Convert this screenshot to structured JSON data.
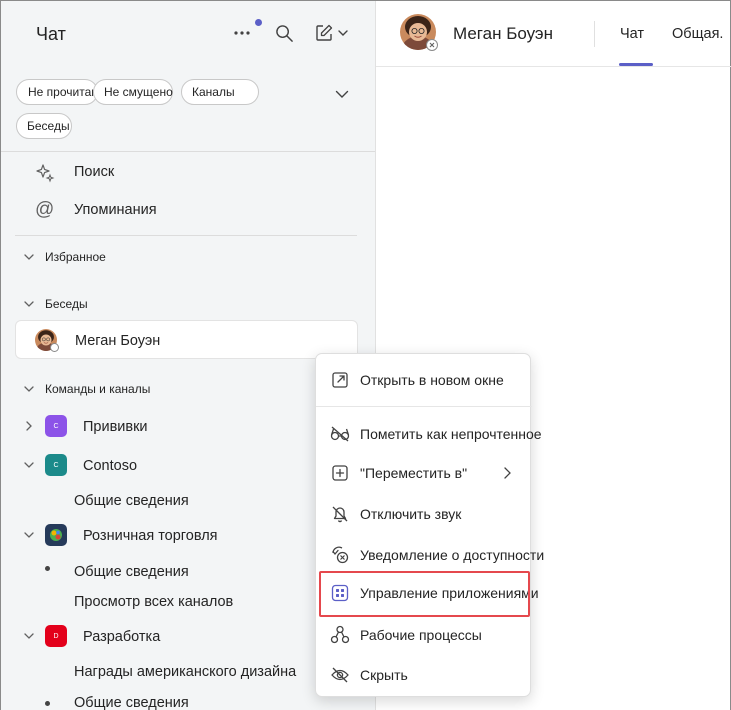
{
  "sidebar": {
    "title": "Чат",
    "filters": [
      "Не прочитано",
      "Не смущено",
      "Каналы",
      "Беседы"
    ],
    "quick": [
      {
        "label": "Поиск",
        "icon": "sparkle-icon"
      },
      {
        "label": "Упоминания",
        "icon": "at-icon"
      }
    ],
    "sections": {
      "favorites": "Избранное",
      "chats": "Беседы",
      "teams": "Команды и каналы"
    },
    "chat_item": "Меган Боуэн",
    "teams": [
      {
        "name": "Прививки",
        "letter": "C",
        "color": "#8c53e8"
      },
      {
        "name": "Contoso",
        "letter": "C",
        "color": "#1b8a8a"
      },
      {
        "name": "Розничная торговля",
        "letter": "",
        "color": "#253a5a"
      },
      {
        "name": "Разработка",
        "letter": "D",
        "color": "#e3001b"
      }
    ],
    "channels": {
      "contoso_general": "Общие сведения",
      "retail_general": "Общие сведения",
      "retail_all": "Просмотр всех каналов",
      "dev_awards": "Награды американского дизайна",
      "dev_general": "Общие сведения"
    }
  },
  "header": {
    "name": "Меган Боуэн",
    "tabs": [
      "Чат",
      "Общая."
    ]
  },
  "context_menu": {
    "items": [
      {
        "label": "Открыть в новом окне",
        "icon": "open-window-icon"
      },
      {
        "label": "Пометить как непрочтенное",
        "icon": "glasses-icon"
      },
      {
        "label": "\"Переместить в\"",
        "icon": "plus-square-icon"
      },
      {
        "label": "Отключить звук",
        "icon": "bell-off-icon"
      },
      {
        "label": "Уведомление о доступности",
        "icon": "presence-icon"
      },
      {
        "label": "Управление приложениями",
        "icon": "apps-icon"
      },
      {
        "label": "Рабочие процессы",
        "icon": "workflow-icon"
      },
      {
        "label": "Скрыть",
        "icon": "eye-off-icon"
      }
    ]
  },
  "colors": {
    "accent": "#5b5fc7",
    "highlight": "#e5484d"
  }
}
